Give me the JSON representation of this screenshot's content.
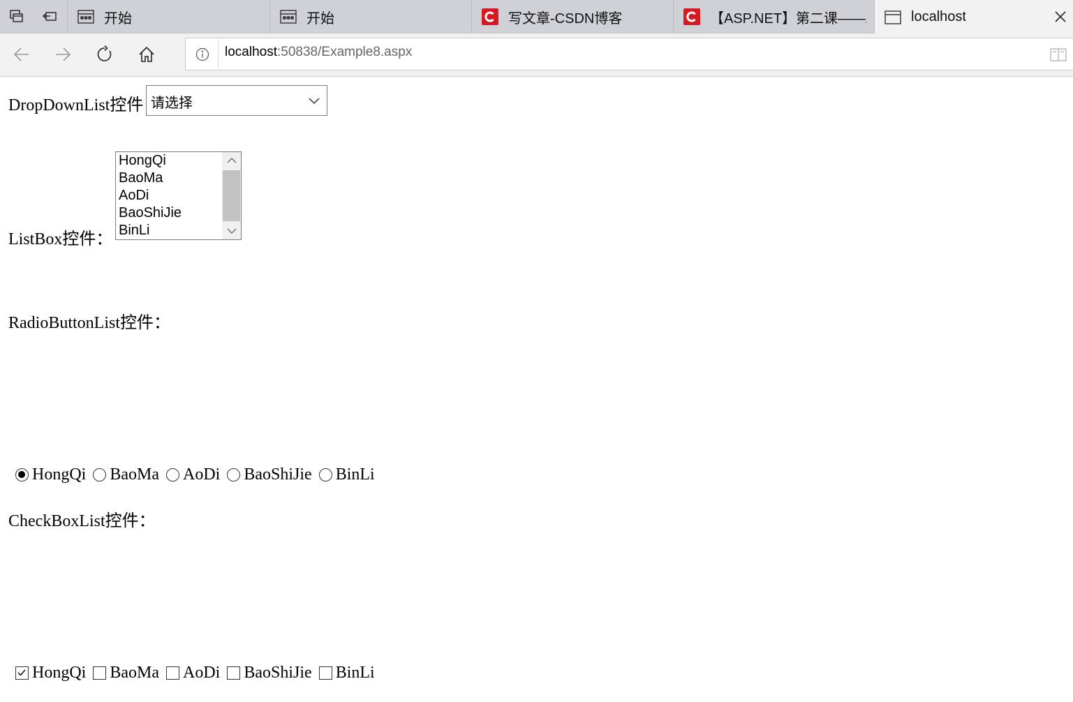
{
  "browser": {
    "tabs": [
      {
        "label": "开始",
        "icon": "start-page-icon"
      },
      {
        "label": "开始",
        "icon": "start-page-icon"
      },
      {
        "label": "写文章-CSDN博客",
        "icon": "csdn-logo-icon"
      },
      {
        "label": "【ASP.NET】第二课——A:",
        "icon": "csdn-logo-icon"
      },
      {
        "label": "localhost",
        "icon": "page-icon",
        "active": true
      }
    ],
    "address": {
      "host": "localhost",
      "rest": ":50838/Example8.aspx"
    },
    "colors": {
      "tabstrip": "#cfd1d6",
      "toolbar": "#f2f2f2",
      "csdn": "#d41b23"
    }
  },
  "page": {
    "dropdown": {
      "label": "DropDownList控件",
      "selected": "请选择"
    },
    "listbox": {
      "label": "ListBox控件：",
      "items": [
        "HongQi",
        "BaoMa",
        "AoDi",
        "BaoShiJie",
        "BinLi"
      ]
    },
    "radiolist": {
      "label": "RadioButtonList控件：",
      "options": [
        "HongQi",
        "BaoMa",
        "AoDi",
        "BaoShiJie",
        "BinLi"
      ],
      "selected": "HongQi"
    },
    "checklist": {
      "label": "CheckBoxList控件：",
      "options": [
        "HongQi",
        "BaoMa",
        "AoDi",
        "BaoShiJie",
        "BinLi"
      ],
      "checked": [
        "HongQi"
      ]
    }
  }
}
